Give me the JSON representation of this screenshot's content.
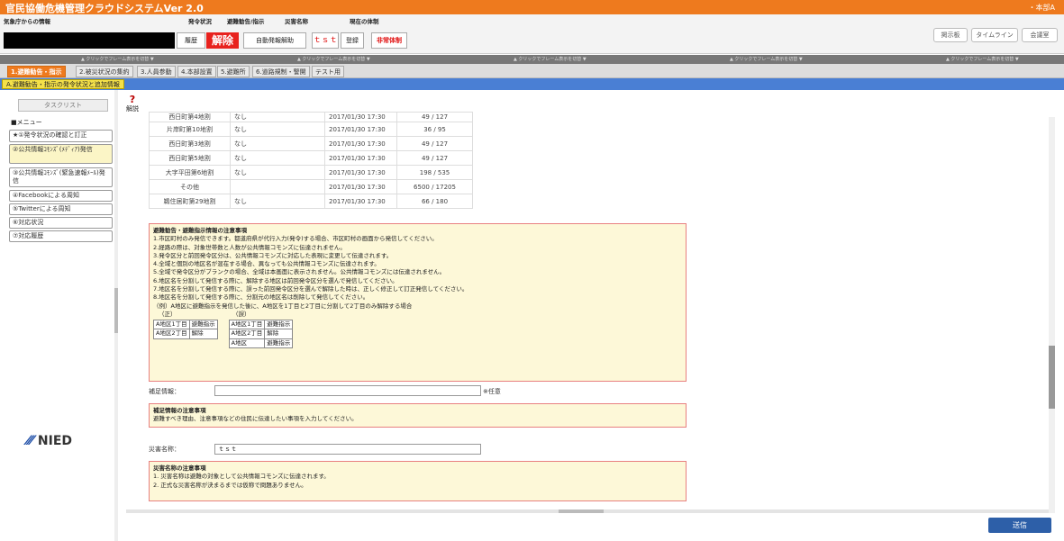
{
  "app": {
    "title": "官民協働危機管理クラウドシステムVer 2.0",
    "user": "・本部A"
  },
  "header": {
    "source_label": "気象庁からの情報",
    "status_label": "発令状況",
    "evac_label": "避難勧告/指示",
    "disaster_label": "災害名称",
    "current_label": "現在の体制",
    "history_btn": "履歴",
    "status_value": "解除",
    "auto_btn": "自動発報解助",
    "disaster_value": "ｔｓｔ",
    "register_btn": "登録",
    "system_state": "非常体制",
    "right_buttons": [
      "掲示板",
      "タイムライン",
      "会議室"
    ]
  },
  "gbar_text": "▲ クリックでフレーム表示を切替 ▼",
  "tabs": [
    "1.避難勧告・指示",
    "2.被災状況の集約",
    "3.人員参動",
    "4.本部設置",
    "5.避難所",
    "6.道路規制・警開",
    "テスト用"
  ],
  "subtab": "A.避難勧告・指示の発令状況と追加情報",
  "sidebar": {
    "tasklist": "タスクリスト",
    "menu": "■メニュー",
    "items": [
      "★①発令状況の確認と訂正",
      "②公共情報ｺﾓﾝｽﾞ(ﾒﾃﾞｨｱ)発信",
      "③公共情報ｺﾓﾝｽﾞ(緊急速報ﾒｰﾙ)発信",
      "④Facebookによる周知",
      "⑤Twitterによる周知",
      "⑥対応状況",
      "⑦対応履歴"
    ],
    "logo": "NIED"
  },
  "help": "解説",
  "table": [
    [
      "西日町第4地割",
      "なし",
      "2017/01/30 17:30",
      "49 / 127"
    ],
    [
      "片岸町第10地割",
      "なし",
      "2017/01/30 17:30",
      "36 / 95"
    ],
    [
      "西日町第3地割",
      "なし",
      "2017/01/30 17:30",
      "49 / 127"
    ],
    [
      "西日町第5地割",
      "なし",
      "2017/01/30 17:30",
      "49 / 127"
    ],
    [
      "大字平田第6地割",
      "なし",
      "2017/01/30 17:30",
      "198 / 535"
    ],
    [
      "その他",
      "",
      "2017/01/30 17:30",
      "6500 / 17205"
    ],
    [
      "鵜住居町第29地割",
      "なし",
      "2017/01/30 17:30",
      "66 / 180"
    ]
  ],
  "notice1": {
    "title": "避難勧告・避難指示情報の注意事項",
    "lines": [
      "1.市区町村のみ発信できます。都道府県が代行入力(発令)する場合、市区町村の画面から発信してください。",
      "2.経路の際は、対象世帯数と人数が公共情報コモンズに伝達されません。",
      "3.発令区分と前回発令区分は、公共情報コモンズに対応した表現に変更して伝達されます。",
      "4.全域と個別の地区名が混在する場合、異なっても公共情報コモンズに伝達されます。",
      "5.全域で発令区分がブランクの場合、全域は本画面に表示されません。公共情報コモンズには伝達されません。",
      "6.地区名を分割して発信する際に、解除する地区は前回発令区分を選んで発信してください。",
      "7.地区名を分割して発信する際に、誤った前回発令区分を選んで解除した時は、正しく修正して訂正発信してください。",
      "8.地区名を分割して発信する際に、分割元の地区名は削除して発信してください。",
      "（例）A地区に避難指示を発信した後に、A地区を1丁目と2丁目に分割して2丁目のみ解除する場合"
    ],
    "correct": "（正）",
    "wrong": "（誤）",
    "ex_correct": [
      [
        "A地区1丁目",
        "避難指示"
      ],
      [
        "A地区2丁目",
        "解除"
      ]
    ],
    "ex_wrong": [
      [
        "A地区1丁目",
        "避難指示"
      ],
      [
        "A地区2丁目",
        "解除"
      ],
      [
        "A地区",
        "避難指示"
      ]
    ]
  },
  "supplement": {
    "label": "補足情報：",
    "value": "",
    "suffix": "※任意"
  },
  "notice2": {
    "title": "補足情報の注意事項",
    "line": "避難すべき理由、注意事項などの住民に伝達したい事項を入力してください。"
  },
  "disaster_name": {
    "label": "災害名称：",
    "value": "ｔｓｔ"
  },
  "notice3": {
    "title": "災害名称の注意事項",
    "lines": [
      "1. 災害名称は避難の対象として公共情報コモンズに伝達されます。",
      "2. 正式な災害名称が決まるまでは仮称で問題ありません。"
    ]
  },
  "send": "送信",
  "colors": {
    "title_bar": "#ee7a1e",
    "subbar": "#4a7fd4",
    "status_red": "#e8221e",
    "notice_bg": "#fdf8d8",
    "send_btn": "#2d5fa8"
  }
}
